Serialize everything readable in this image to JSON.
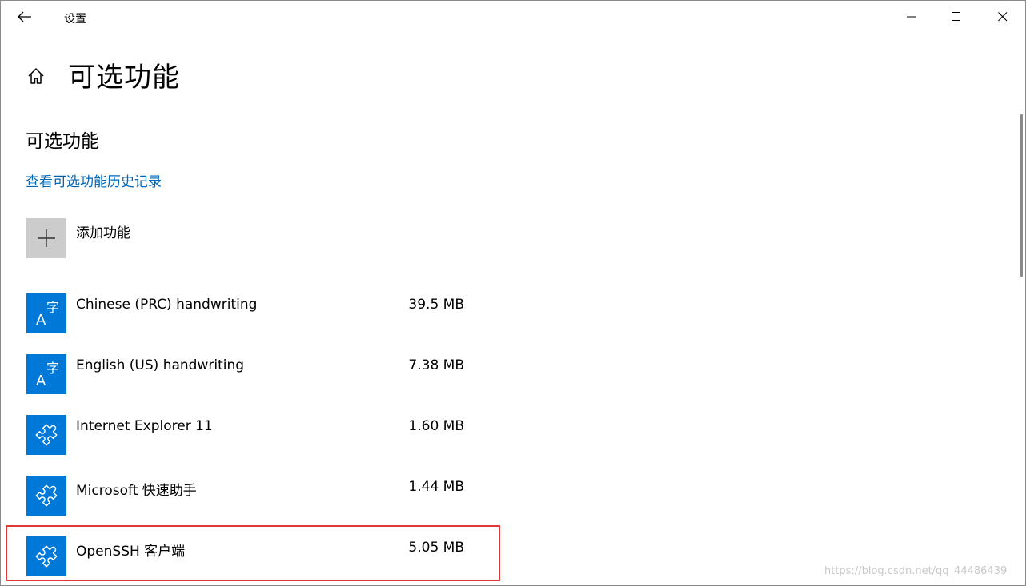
{
  "window": {
    "title": "设置"
  },
  "header": {
    "page_title": "可选功能"
  },
  "section": {
    "title": "可选功能",
    "history_link": "查看可选功能历史记录",
    "add_feature_label": "添加功能"
  },
  "features": [
    {
      "name": "Chinese (PRC) handwriting",
      "size": "39.5 MB",
      "icon": "language-icon"
    },
    {
      "name": "English (US) handwriting",
      "size": "7.38 MB",
      "icon": "language-icon"
    },
    {
      "name": "Internet Explorer 11",
      "size": "1.60 MB",
      "icon": "puzzle-icon"
    },
    {
      "name": "Microsoft 快速助手",
      "size": "1.44 MB",
      "icon": "puzzle-icon"
    },
    {
      "name": "OpenSSH 客户端",
      "size": "5.05 MB",
      "icon": "puzzle-icon"
    }
  ],
  "watermark": "https://blog.csdn.net/qq_44486439",
  "colors": {
    "accent": "#0078d7",
    "link": "#0067b8",
    "highlight": "#e0373b",
    "add_tile": "#cccccc"
  }
}
